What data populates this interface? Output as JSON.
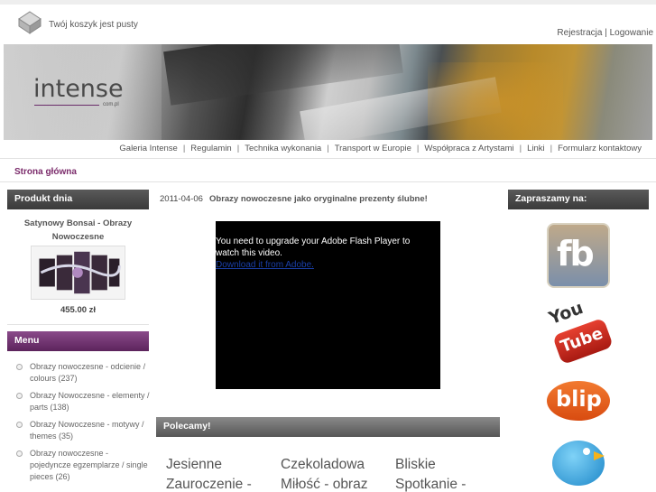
{
  "header": {
    "cart_text": "Twój koszyk jest pusty",
    "register_label": "Rejestracja",
    "auth_separator": "|",
    "login_label": "Logowanie"
  },
  "banner": {
    "logo_text": "intense",
    "logo_sub": "com.pl"
  },
  "nav": {
    "items": [
      "Galeria Intense",
      "Regulamin",
      "Technika wykonania",
      "Transport w Europie",
      "Współpraca z Artystami",
      "Linki",
      "Formularz kontaktowy"
    ],
    "separator": "|"
  },
  "breadcrumb": "Strona główna",
  "product_of_day": {
    "title": "Produkt dnia",
    "name": "Satynowy Bonsai - Obrazy Nowoczesne",
    "price": "455.00 zł"
  },
  "menu": {
    "title": "Menu",
    "items": [
      "Obrazy nowoczesne - odcienie / colours (237)",
      "Obrazy Nowoczesne - elementy / parts (138)",
      "Obrazy Nowoczesne - motywy / themes (35)",
      "Obrazy nowoczesne - pojedyncze egzemplarze / single pieces (26)"
    ]
  },
  "news": {
    "date": "2011-04-06",
    "title": "Obrazy nowoczesne jako oryginalne prezenty ślubne!"
  },
  "flash": {
    "message": "You need to upgrade your Adobe Flash Player to watch this video.",
    "link": "Download it from Adobe."
  },
  "recommended": {
    "title": "Polecamy!",
    "items": [
      {
        "line1": "Jesienne",
        "line2": "Zauroczenie -"
      },
      {
        "line1": "Czekoladowa",
        "line2": "Miłość - obraz"
      },
      {
        "line1": "Bliskie",
        "line2": "Spotkanie -"
      }
    ]
  },
  "social": {
    "title": "Zapraszamy na:",
    "items": [
      "facebook-icon",
      "youtube-icon",
      "blip-icon",
      "twitter-icon"
    ],
    "fb_text": "fb",
    "yt_you": "You",
    "yt_tube": "Tube",
    "blip_text": "blip"
  },
  "colors": {
    "accent_purple": "#7a2a6a",
    "header_dark": "#4a4a4a",
    "flash_bg": "#000000"
  }
}
